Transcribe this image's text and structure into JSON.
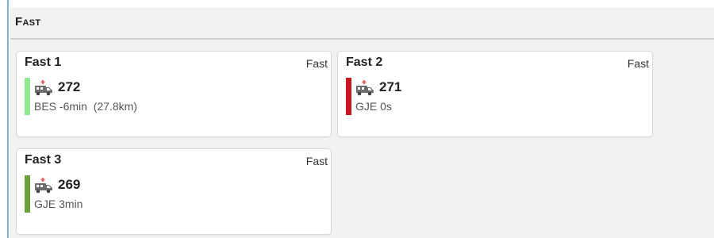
{
  "panel": {
    "title": "Fast"
  },
  "cards": [
    {
      "title": "Fast 1",
      "type_label": "Fast",
      "unit_id": "272",
      "eta": "BES -6min  (27.8km)",
      "status_color": "#90e890",
      "icon": "ambulance-icon"
    },
    {
      "title": "Fast 2",
      "type_label": "Fast",
      "unit_id": "271",
      "eta": "GJE 0s",
      "status_color": "#c8151e",
      "icon": "ambulance-icon"
    },
    {
      "title": "Fast 3",
      "type_label": "Fast",
      "unit_id": "269",
      "eta": "GJE 3min",
      "status_color": "#6aa33a",
      "icon": "ambulance-icon"
    }
  ]
}
